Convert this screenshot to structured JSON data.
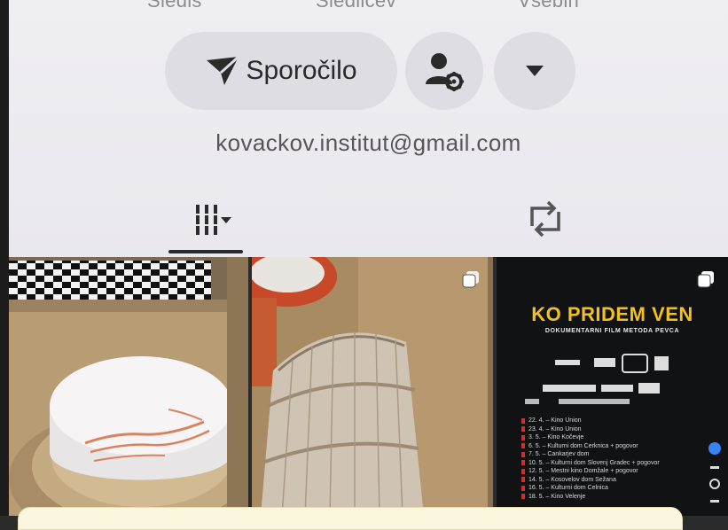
{
  "stats": {
    "labels": [
      "Sledis",
      "Sledilcev",
      "Vsebin"
    ]
  },
  "actions": {
    "message_label": "Sporočilo"
  },
  "profile": {
    "email": "kovackov.institut@gmail.com"
  },
  "tabs": [
    {
      "name": "grid"
    },
    {
      "name": "reposts"
    }
  ],
  "posts": [
    {
      "content": "cake-photo"
    },
    {
      "content": "barrel-model-photo",
      "multi": true
    },
    {
      "content": "film-poster",
      "multi": true,
      "title": "KO PRIDEM VEN",
      "subtitle": "DOKUMENTARNI FILM METODA PEVCA",
      "screenings": [
        "22. 4. – Kino Union",
        "23. 4. – Kino Union",
        "3. 5. – Kino Kočevje",
        "6. 5. – Kulturni dom Cerknica + pogovor",
        "7. 5. – Cankarjev dom",
        "10. 5. – Kulturni dom Slovenj Gradec + pogovor",
        "12. 5. – Mestni kino Domžale + pogovor",
        "14. 5. – Kosovelov dom Sežana",
        "16. 5. – Kulturni dom Celnica",
        "18. 5. – Kino Velenje"
      ]
    }
  ],
  "colors": {
    "poster_title": "#f2c21b",
    "bottom_bar": "#fbf6de"
  }
}
